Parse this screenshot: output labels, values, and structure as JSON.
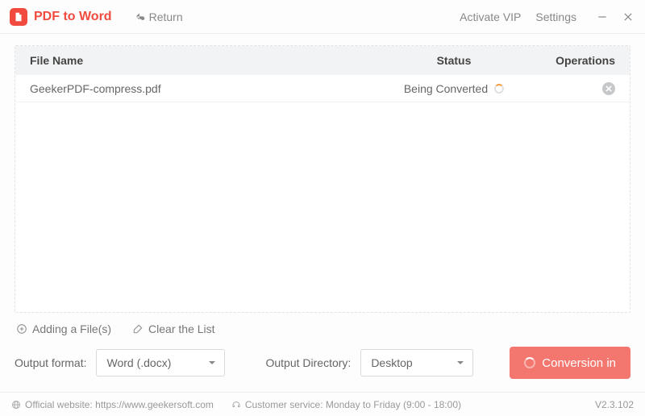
{
  "header": {
    "title": "PDF to Word",
    "return": "Return",
    "activate_vip": "Activate VIP",
    "settings": "Settings"
  },
  "table": {
    "headers": {
      "file": "File Name",
      "status": "Status",
      "ops": "Operations"
    },
    "rows": [
      {
        "file": "GeekerPDF-compress.pdf",
        "status": "Being Converted"
      }
    ]
  },
  "list_actions": {
    "add": "Adding a File(s)",
    "clear": "Clear the List"
  },
  "controls": {
    "format_label": "Output format:",
    "format_value": "Word (.docx)",
    "dir_label": "Output Directory:",
    "dir_value": "Desktop",
    "convert": "Conversion in"
  },
  "footer": {
    "website_label": "Official website: https://www.geekersoft.com",
    "customer_label": "Customer service: Monday to Friday (9:00 - 18:00)",
    "version": "V2.3.102"
  }
}
